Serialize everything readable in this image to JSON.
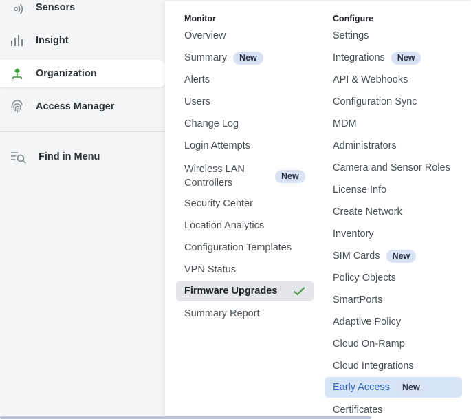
{
  "sidebar": {
    "items": [
      {
        "label": "Sensors",
        "icon": "sensor-icon"
      },
      {
        "label": "Insight",
        "icon": "insight-bars-icon"
      },
      {
        "label": "Organization",
        "icon": "organization-icon",
        "active": true
      },
      {
        "label": "Access Manager",
        "icon": "fingerprint-icon"
      }
    ],
    "find_label": "Find in Menu"
  },
  "menu": {
    "monitor": {
      "heading": "Monitor",
      "items": [
        {
          "label": "Overview"
        },
        {
          "label": "Summary",
          "badge": "New"
        },
        {
          "label": "Alerts"
        },
        {
          "label": "Users"
        },
        {
          "label": "Change Log"
        },
        {
          "label": "Login Attempts"
        },
        {
          "label": "Wireless LAN Controllers",
          "badge": "New"
        },
        {
          "label": "Security Center"
        },
        {
          "label": "Location Analytics"
        },
        {
          "label": "Configuration Templates"
        },
        {
          "label": "VPN Status"
        },
        {
          "label": "Firmware Upgrades",
          "selected": true
        },
        {
          "label": "Summary Report"
        }
      ]
    },
    "configure": {
      "heading": "Configure",
      "items": [
        {
          "label": "Settings"
        },
        {
          "label": "Integrations",
          "badge": "New"
        },
        {
          "label": "API & Webhooks"
        },
        {
          "label": "Configuration Sync"
        },
        {
          "label": "MDM"
        },
        {
          "label": "Administrators"
        },
        {
          "label": "Camera and Sensor Roles"
        },
        {
          "label": "License Info"
        },
        {
          "label": "Create Network"
        },
        {
          "label": "Inventory"
        },
        {
          "label": "SIM Cards",
          "badge": "New"
        },
        {
          "label": "Policy Objects"
        },
        {
          "label": "SmartPorts"
        },
        {
          "label": "Adaptive Policy"
        },
        {
          "label": "Cloud On-Ramp"
        },
        {
          "label": "Cloud Integrations"
        },
        {
          "label": "Early Access",
          "badge": "New",
          "highlighted": true
        },
        {
          "label": "Certificates"
        }
      ]
    }
  },
  "colors": {
    "accent_blue": "#2a62c7",
    "badge_bg": "#d7e2f3",
    "check_green": "#3a9a3a",
    "org_green": "#3ea23e"
  }
}
